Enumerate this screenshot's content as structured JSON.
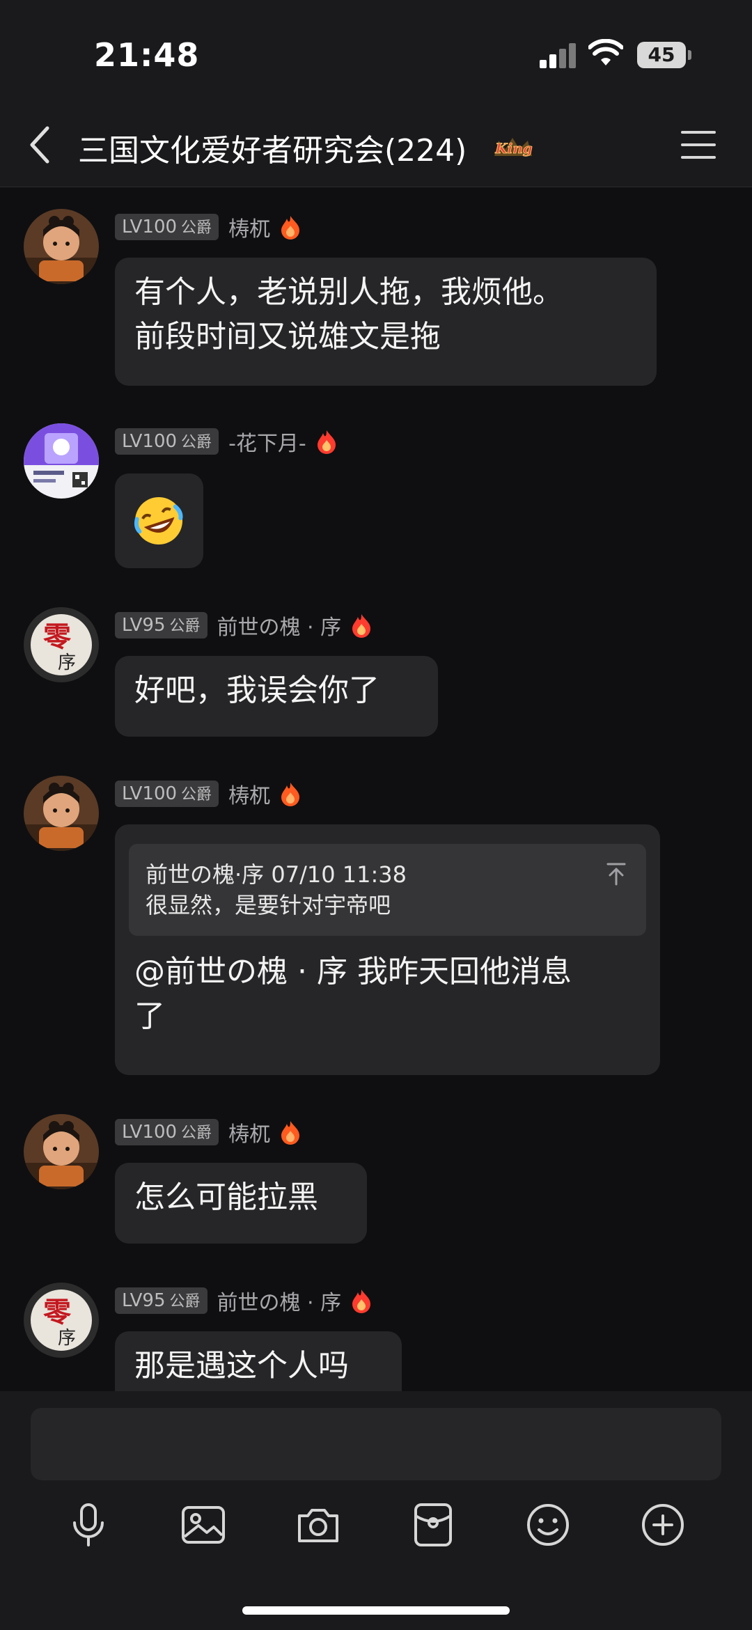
{
  "status": {
    "time": "21:48",
    "battery": "45"
  },
  "header": {
    "title": "三国文化爱好者研究会(224)",
    "badge": "king"
  },
  "messages": [
    {
      "level": "LV100",
      "rank": "公爵",
      "sender": "梼杌",
      "text": "有个人，老说别人拖，我烦他。\n前段时间又说雄文是拖"
    },
    {
      "level": "LV100",
      "rank": "公爵",
      "sender": "-花下月-",
      "emoji": "rolling-on-floor-laughing"
    },
    {
      "level": "LV95",
      "rank": "公爵",
      "sender": "前世の槐 · 序",
      "text": "好吧，我误会你了"
    },
    {
      "level": "LV100",
      "rank": "公爵",
      "sender": "梼杌",
      "quote": {
        "header": "前世の槐·序 07/10 11:38",
        "body": "很显然，是要针对宇帝吧"
      },
      "text": "@前世の槐 · 序 我昨天回他消息\n了"
    },
    {
      "level": "LV100",
      "rank": "公爵",
      "sender": "梼杌",
      "text": "怎么可能拉黑"
    },
    {
      "level": "LV95",
      "rank": "公爵",
      "sender": "前世の槐 · 序",
      "text": "那是遇这个人吗"
    }
  ],
  "toolbar": [
    "microphone-icon",
    "image-icon",
    "camera-icon",
    "red-packet-icon",
    "emoji-icon",
    "plus-icon"
  ],
  "colors": {
    "background": "#0f0f11",
    "bubble": "#262628",
    "bar": "#1a1a1c",
    "flame": "#ff5a1f"
  }
}
